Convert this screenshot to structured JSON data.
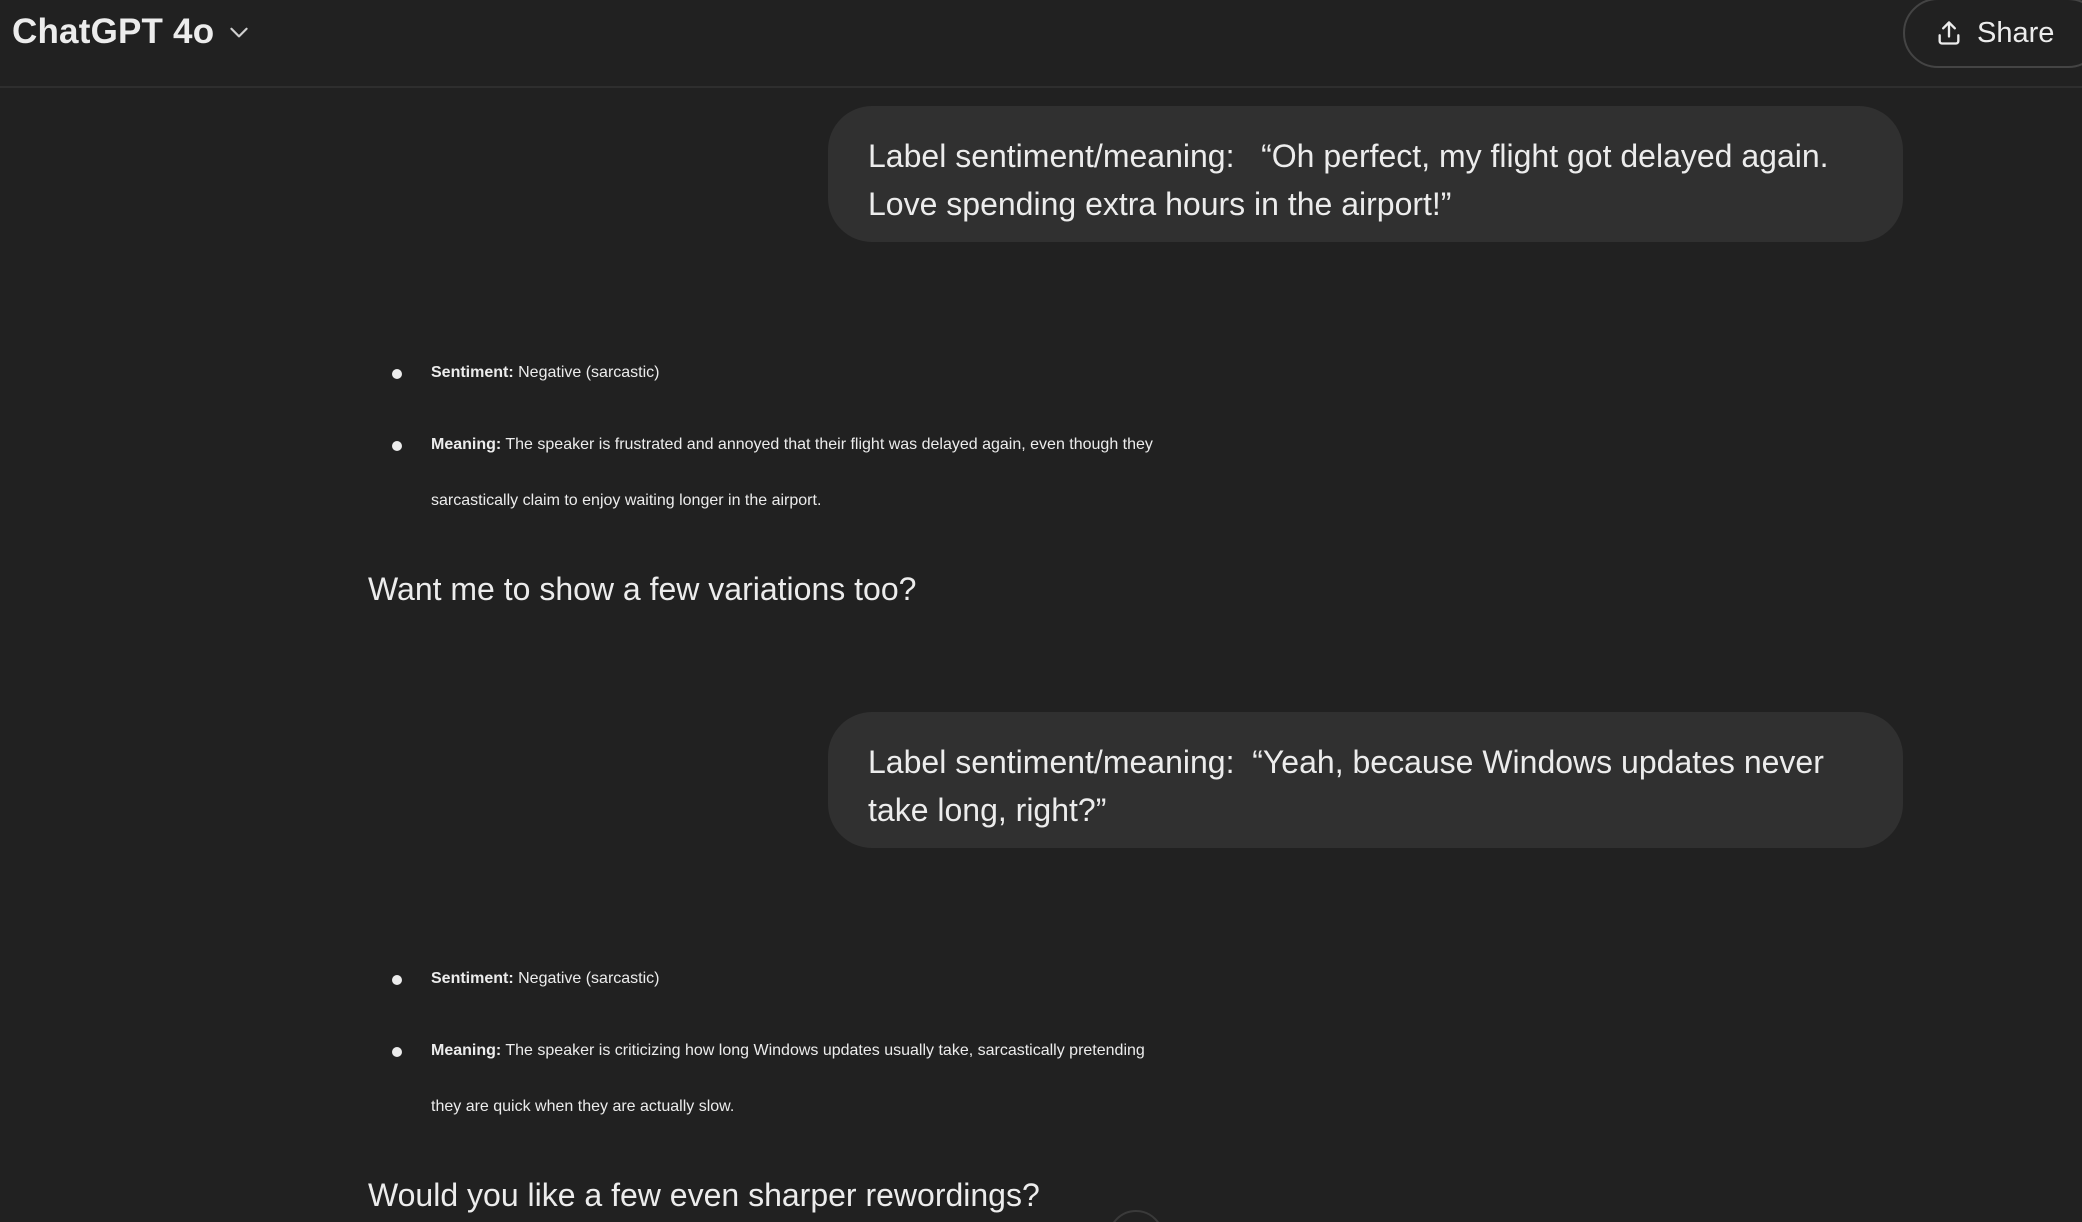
{
  "header": {
    "model_name": "ChatGPT 4o",
    "model_chevron_icon": "chevron-down-icon",
    "share_label": "Share",
    "share_icon": "share-upload-icon"
  },
  "conversation": [
    {
      "user": {
        "prefix": "Label sentiment/meaning:",
        "quote": "“Oh perfect, my flight got delayed again. Love spending extra hours in the airport!”",
        "line1": "Label sentiment/meaning:   “Oh perfect, my flight got delayed again.",
        "line2": "Love spending extra hours in the airport!”"
      },
      "assistant": {
        "sentiment_label": "Sentiment:",
        "sentiment_value": "Negative (sarcastic)",
        "meaning_label": "Meaning:",
        "meaning_value_line1": "The speaker is frustrated and annoyed that their flight was delayed again, even though they",
        "meaning_value_line2": "sarcastically claim to enjoy waiting longer in the airport.",
        "followup": "Want me to show a few variations too?"
      }
    },
    {
      "user": {
        "prefix": "Label sentiment/meaning:",
        "quote": "“Yeah, because Windows updates never take long, right?”",
        "line1": "Label sentiment/meaning:  “Yeah, because Windows updates never",
        "line2": "take long, right?”"
      },
      "assistant": {
        "sentiment_label": "Sentiment:",
        "sentiment_value": "Negative (sarcastic)",
        "meaning_label": "Meaning:",
        "meaning_value_line1": "The speaker is criticizing how long Windows updates usually take, sarcastically pretending",
        "meaning_value_line2": "they are quick when they are actually slow.",
        "followup": "Would you like a few even sharper rewordings?"
      }
    }
  ],
  "colors": {
    "background": "#212121",
    "user_bubble": "#303030",
    "text": "#ececec",
    "divider": "#2e2e2e"
  }
}
